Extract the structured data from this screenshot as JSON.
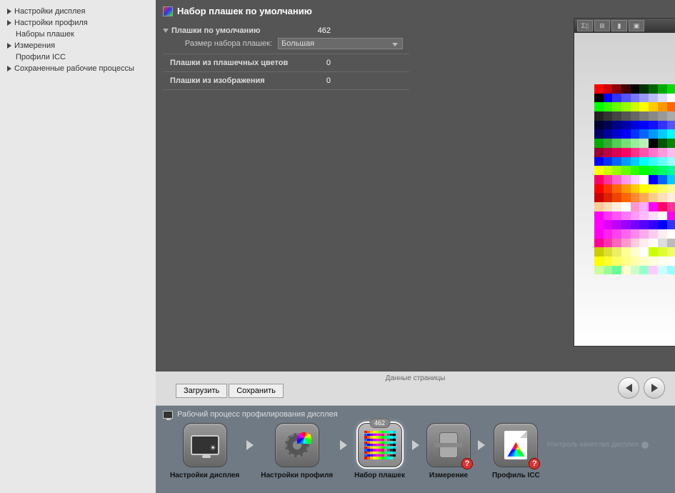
{
  "sidebar": {
    "items": [
      {
        "label": "Настройки дисплея",
        "expandable": true
      },
      {
        "label": "Настройки профиля",
        "expandable": true
      },
      {
        "label": "Наборы плашек",
        "expandable": false
      },
      {
        "label": "Измерения",
        "expandable": true
      },
      {
        "label": "Профили ICC",
        "expandable": false
      },
      {
        "label": "Сохраненные рабочие процессы",
        "expandable": true
      }
    ]
  },
  "header": {
    "title": "Набор плашек по умолчанию"
  },
  "settings": {
    "default_patches": {
      "label": "Плашки по умолчанию",
      "value": "462"
    },
    "set_size": {
      "label": "Размер набора плашек:",
      "value": "Большая"
    },
    "spot_patches": {
      "label": "Плашки из плашечных цветов",
      "value": "0"
    },
    "image_patches": {
      "label": "Плашки из изображения",
      "value": "0"
    }
  },
  "preview_toolbar": {
    "btn1": "Σ▯",
    "btn2": "⊞",
    "btn3": "▮",
    "btn4": "▣"
  },
  "footer": {
    "page_data_label": "Данные страницы",
    "load": "Загрузить",
    "save": "Сохранить",
    "back": "Назад",
    "next": "Далее"
  },
  "workflow": {
    "title": "Рабочий процесс профилирования дисплея",
    "steps": [
      {
        "label": "Настройки дисплея"
      },
      {
        "label": "Настройки профиля"
      },
      {
        "label": "Набор плашек",
        "active": true,
        "count": "462"
      },
      {
        "label": "Измерение",
        "alert": true
      },
      {
        "label": "Профиль ICC",
        "alert": true
      }
    ],
    "disabled": "Контроль качества дисплея"
  }
}
